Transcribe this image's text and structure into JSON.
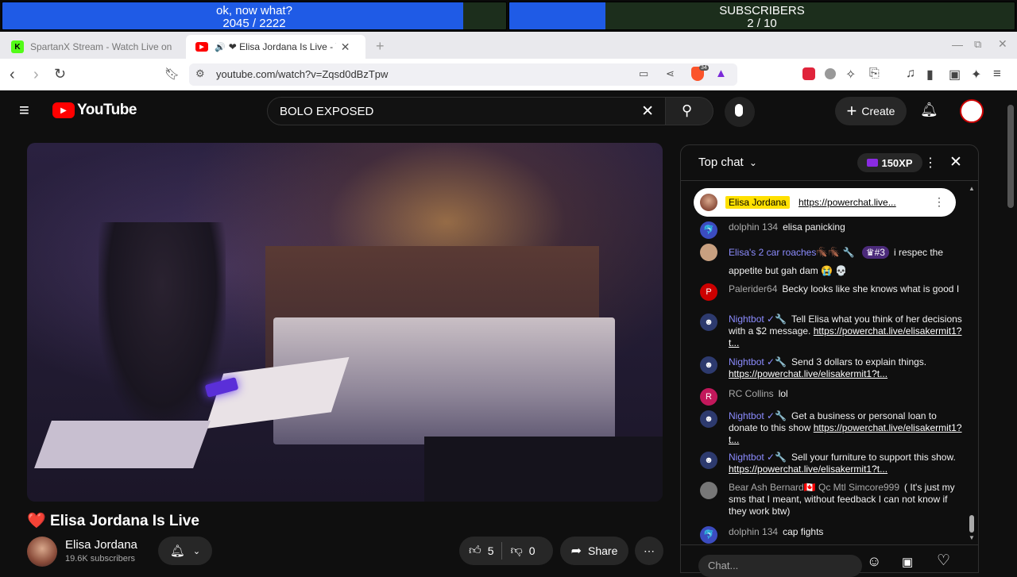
{
  "overlay": {
    "goal1": {
      "label": "ok, now what?",
      "count": "2045 / 2222",
      "progress": 0.92
    },
    "goal2": {
      "label": "SUBSCRIBERS",
      "count": "2 / 10",
      "progress": 0.2
    }
  },
  "browser": {
    "tabs": [
      {
        "title": "SpartanX Stream - Watch Live on",
        "favicon": "K",
        "favicon_color": "#53fc18"
      },
      {
        "title": "❤ Elisa Jordana Is Live - Yo",
        "favicon": "youtube-icon",
        "favicon_color": "#ff0000",
        "active": true
      }
    ],
    "url": "youtube.com/watch?v=Zqsd0dBzTpw",
    "extensions": {
      "brave_badge": "34"
    }
  },
  "youtube": {
    "logo_text": "YouTube",
    "search_value": "BOLO EXPOSED",
    "create_label": "Create",
    "video": {
      "title": "Elisa Jordana Is Live",
      "title_prefix": "❤️",
      "channel": "Elisa Jordana",
      "subscribers": "19.6K subscribers",
      "likes": "5",
      "dislikes": "0",
      "share_label": "Share"
    },
    "chat": {
      "mode_label": "Top chat",
      "xp_label": "150XP",
      "pinned": {
        "author": "Elisa Jordana",
        "text": "https://powerchat.live..."
      },
      "input_placeholder": "Chat...",
      "messages": [
        {
          "author": "dolphin 134",
          "text": "elisa panicking",
          "avatar_color": "#3b4cc0"
        },
        {
          "author": "Elisa's 2 car roaches🪳🪳 🔧",
          "badge": "#3",
          "text": "i respec the appetite but gah dam 😭 💀",
          "avatar_color": "#c8a080"
        },
        {
          "author": "Palerider64",
          "text": "Becky looks like she knows what is good I",
          "avatar_color": "#c00",
          "initial": "P"
        },
        {
          "author": "Nightbot ✓🔧",
          "text": "Tell Elisa what you think of her decisions with a $2 message.",
          "link": "https://powerchat.live/elisakermit1?t...",
          "avatar_color": "#2d3a6e"
        },
        {
          "author": "Nightbot ✓🔧",
          "text": "Send 3 dollars to explain things.",
          "link": "https://powerchat.live/elisakermit1?t...",
          "avatar_color": "#2d3a6e"
        },
        {
          "author": "RC Collins",
          "text": "lol",
          "avatar_color": "#c2185b",
          "initial": "R"
        },
        {
          "author": "Nightbot ✓🔧",
          "text": "Get a business or personal loan to donate to this show",
          "link": "https://powerchat.live/elisakermit1?t...",
          "avatar_color": "#2d3a6e"
        },
        {
          "author": "Nightbot ✓🔧",
          "text": "Sell your furniture to support this show.",
          "link": "https://powerchat.live/elisakermit1?t...",
          "avatar_color": "#2d3a6e"
        },
        {
          "author": "Bear Ash Bernard🇨🇦 Qc Mtl Simcore999",
          "text": "( It's just my sms that I meant, without feedback I can not know if they work btw)",
          "avatar_color": "#777"
        },
        {
          "author": "dolphin 134",
          "text": "cap fights",
          "avatar_color": "#3b4cc0"
        }
      ]
    }
  }
}
